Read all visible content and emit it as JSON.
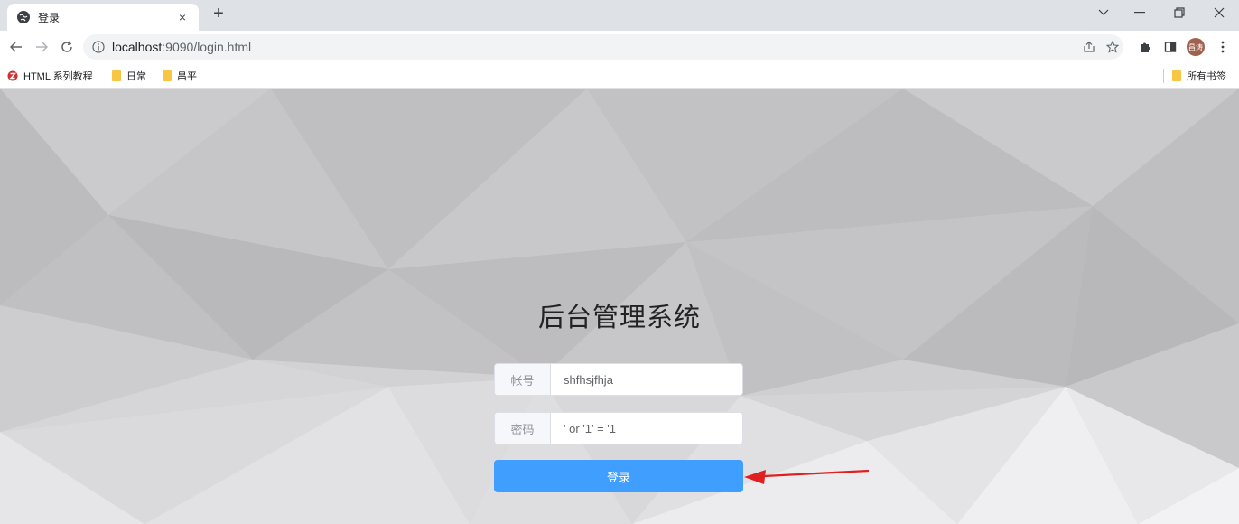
{
  "tab": {
    "title": "登录",
    "close": "×",
    "new_tab": "+"
  },
  "toolbar": {
    "url_host": "localhost",
    "url_rest": ":9090/login.html",
    "avatar_text": "昌涛"
  },
  "bookmarks": {
    "items": [
      {
        "label": "HTML 系列教程",
        "icon": "html-tutorial-icon"
      },
      {
        "label": "日常",
        "icon": "folder-icon"
      },
      {
        "label": "昌平",
        "icon": "folder-icon"
      }
    ],
    "all_bookmarks": "所有书签"
  },
  "login": {
    "title": "后台管理系统",
    "username_label": "帐号",
    "username_value": "shfhsjfhja",
    "password_label": "密码",
    "password_value": "' or '1' = '1",
    "submit_label": "登录"
  },
  "colors": {
    "primary": "#409eff",
    "annotation_arrow": "#e02020"
  }
}
